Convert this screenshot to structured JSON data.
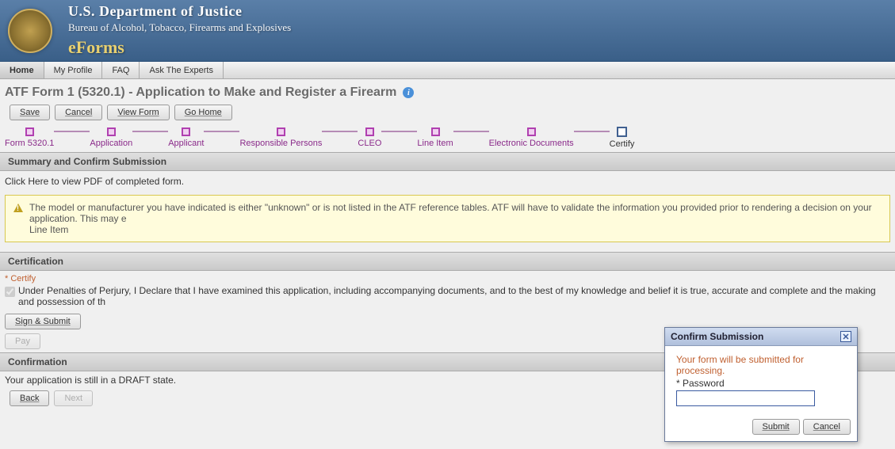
{
  "header": {
    "dept": "U.S. Department of Justice",
    "bureau": "Bureau of Alcohol, Tobacco, Firearms and Explosives",
    "brand": "eForms"
  },
  "tabs": {
    "home": "Home",
    "profile": "My Profile",
    "faq": "FAQ",
    "experts": "Ask The Experts"
  },
  "page_title": "ATF Form 1 (5320.1) - Application to Make and Register a Firearm",
  "toolbar": {
    "save": "Save",
    "cancel": "Cancel",
    "view_form": "View Form",
    "go_home": "Go Home"
  },
  "wizard": {
    "s0": "Form 5320.1",
    "s1": "Application",
    "s2": "Applicant",
    "s3": "Responsible Persons",
    "s4": "CLEO",
    "s5": "Line Item",
    "s6": "Electronic Documents",
    "s7": "Certify"
  },
  "summary": {
    "head": "Summary and Confirm Submission",
    "pdf_link": "Click Here to view PDF of completed form.",
    "warning_l1": "The model or manufacturer you have indicated is either \"unknown\" or is not listed in the ATF reference tables. ATF will have to validate the information you provided prior to rendering a decision on your application. This may e",
    "warning_l2": "Line Item"
  },
  "certification": {
    "head": "Certification",
    "label": "* Certify",
    "text": "Under Penalties of Perjury, I Declare that I have examined this application, including accompanying documents, and to the best of my knowledge and belief it is true, accurate and complete and the making and possession of th",
    "sign_submit": "Sign & Submit",
    "pay": "Pay"
  },
  "confirmation": {
    "head": "Confirmation",
    "text": "Your application is still in a DRAFT state.",
    "back": "Back",
    "next": "Next"
  },
  "dialog": {
    "title": "Confirm Submission",
    "message": "Your form will be submitted for processing.",
    "pw_label": "* Password",
    "submit": "Submit",
    "cancel": "Cancel"
  }
}
